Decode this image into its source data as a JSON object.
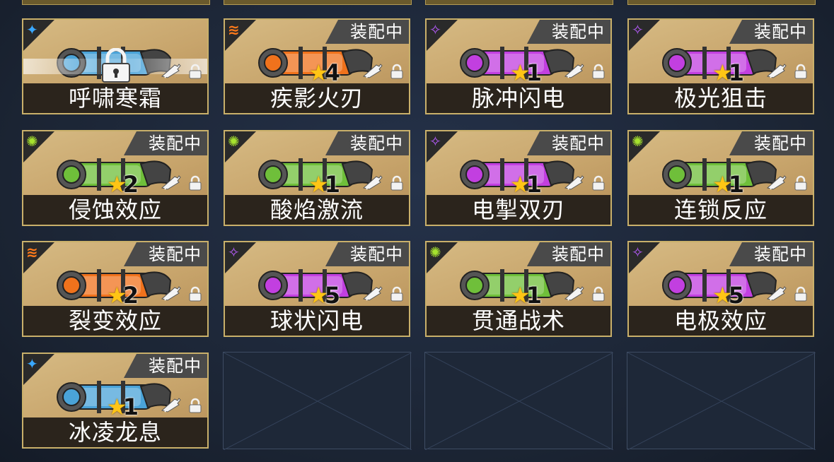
{
  "equip_label": "装配中",
  "weapons": [
    {
      "name": "呼啸寒霜",
      "stars": null,
      "equipped": false,
      "locked": true,
      "element": "ice",
      "color": "#3aa8ff",
      "barrel": "#4aa3d8"
    },
    {
      "name": "疾影火刃",
      "stars": 4,
      "equipped": true,
      "locked": false,
      "element": "fire",
      "color": "#ff7a1a",
      "barrel": "#f0721c"
    },
    {
      "name": "脉冲闪电",
      "stars": 1,
      "equipped": true,
      "locked": false,
      "element": "electric",
      "color": "#b85cff",
      "barrel": "#c23fe0"
    },
    {
      "name": "极光狙击",
      "stars": 1,
      "equipped": true,
      "locked": false,
      "element": "electric",
      "color": "#b85cff",
      "barrel": "#c23fe0"
    },
    {
      "name": "侵蚀效应",
      "stars": 2,
      "equipped": true,
      "locked": false,
      "element": "acid",
      "color": "#a6e22e",
      "barrel": "#6fbf3a"
    },
    {
      "name": "酸焰激流",
      "stars": 1,
      "equipped": true,
      "locked": false,
      "element": "acid",
      "color": "#a6e22e",
      "barrel": "#6fbf3a"
    },
    {
      "name": "电掣双刃",
      "stars": 1,
      "equipped": true,
      "locked": false,
      "element": "electric",
      "color": "#b85cff",
      "barrel": "#c23fe0"
    },
    {
      "name": "连锁反应",
      "stars": 1,
      "equipped": true,
      "locked": false,
      "element": "acid",
      "color": "#a6e22e",
      "barrel": "#6fbf3a"
    },
    {
      "name": "裂变效应",
      "stars": 2,
      "equipped": true,
      "locked": false,
      "element": "fire",
      "color": "#ff7a1a",
      "barrel": "#f0721c"
    },
    {
      "name": "球状闪电",
      "stars": 5,
      "equipped": true,
      "locked": false,
      "element": "electric",
      "color": "#b85cff",
      "barrel": "#c23fe0"
    },
    {
      "name": "贯通战术",
      "stars": 1,
      "equipped": true,
      "locked": false,
      "element": "acid",
      "color": "#a6e22e",
      "barrel": "#6fbf3a"
    },
    {
      "name": "电极效应",
      "stars": 5,
      "equipped": true,
      "locked": false,
      "element": "electric",
      "color": "#b85cff",
      "barrel": "#c23fe0"
    },
    {
      "name": "冰凌龙息",
      "stars": 1,
      "equipped": true,
      "locked": false,
      "element": "ice",
      "color": "#3aa8ff",
      "barrel": "#4aa3d8"
    }
  ],
  "empty_slots": 3
}
